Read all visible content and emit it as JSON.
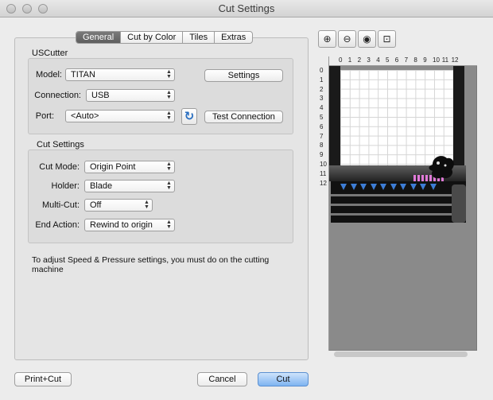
{
  "window": {
    "title": "Cut Settings"
  },
  "tabs": [
    {
      "label": "General",
      "active": true
    },
    {
      "label": "Cut by Color",
      "active": false
    },
    {
      "label": "Tiles",
      "active": false
    },
    {
      "label": "Extras",
      "active": false
    }
  ],
  "cutter_group": {
    "title": "USCutter",
    "model_label": "Model:",
    "model_value": "TITAN",
    "settings_button": "Settings",
    "connection_label": "Connection:",
    "connection_value": "USB",
    "port_label": "Port:",
    "port_value": "<Auto>",
    "test_button": "Test Connection"
  },
  "cut_settings_group": {
    "title": "Cut Settings",
    "cut_mode_label": "Cut Mode:",
    "cut_mode_value": "Origin Point",
    "holder_label": "Holder:",
    "holder_value": "Blade",
    "multicut_label": "Multi-Cut:",
    "multicut_value": "Off",
    "end_action_label": "End Action:",
    "end_action_value": "Rewind to origin"
  },
  "note": "To adjust Speed & Pressure settings, you must do on the cutting machine",
  "footer": {
    "print_cut": "Print+Cut",
    "cancel": "Cancel",
    "cut": "Cut"
  },
  "preview": {
    "ruler_top": [
      "0",
      "1",
      "2",
      "3",
      "4",
      "5",
      "6",
      "7",
      "8",
      "9",
      "10",
      "11",
      "12"
    ],
    "ruler_left": [
      "0",
      "1",
      "2",
      "3",
      "4",
      "5",
      "6",
      "7",
      "8",
      "9",
      "10",
      "11",
      "12"
    ],
    "zoom_tools": [
      "zoom-in-icon",
      "zoom-out-icon",
      "zoom-fit-icon",
      "zoom-page-icon"
    ]
  },
  "colors": {
    "accent": "#3d7dd6",
    "primary_button": "#7fb4f1",
    "tab_active": "#6a6a6a"
  }
}
